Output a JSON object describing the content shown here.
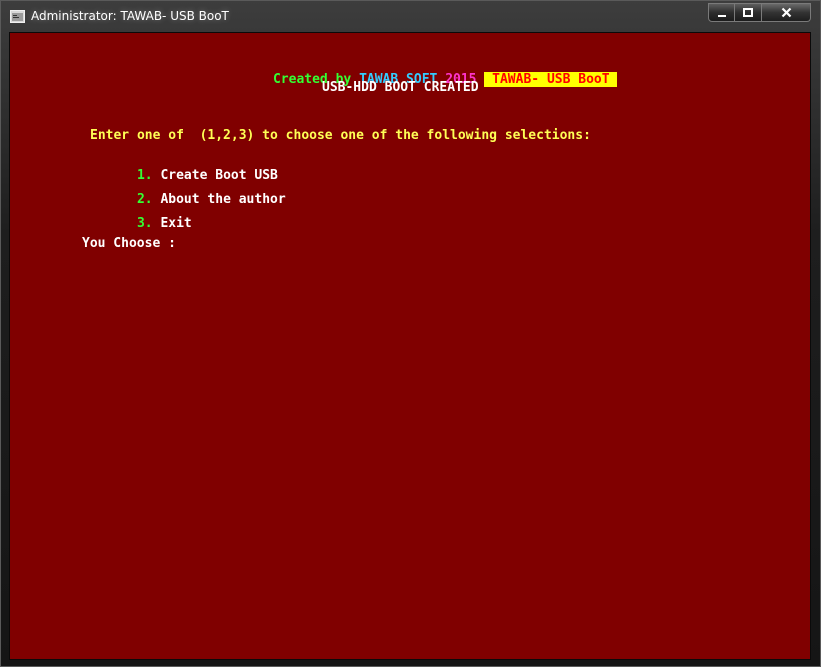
{
  "window": {
    "title": "Administrator:  TAWAB- USB BooT",
    "icon": "console-app-icon",
    "controls": {
      "minimize": "▁",
      "maximize": "☐",
      "close": "✕"
    }
  },
  "console": {
    "background": "#800000",
    "header": {
      "created_by": "Created by",
      "company": "TAWAB SOFT",
      "year": "2015",
      "product": " TAWAB- USB BooT ",
      "colors": {
        "created_by": "#33ff33",
        "company": "#33ccff",
        "year": "#ff33cc",
        "product_text": "#ff0000",
        "product_bg": "#ffff00"
      }
    },
    "subtitle": "USB-HDD BOOT CREATED",
    "prompt": "Enter one of  (1,2,3) to choose one of the following selections:",
    "menu": [
      {
        "number": "1.",
        "label": "Create Boot USB"
      },
      {
        "number": "2.",
        "label": "About the author"
      },
      {
        "number": "3.",
        "label": "Exit"
      }
    ],
    "input_prompt": "You Choose :",
    "colors": {
      "white": "#ffffff",
      "yellow": "#ffff55",
      "green": "#33ff33"
    }
  }
}
